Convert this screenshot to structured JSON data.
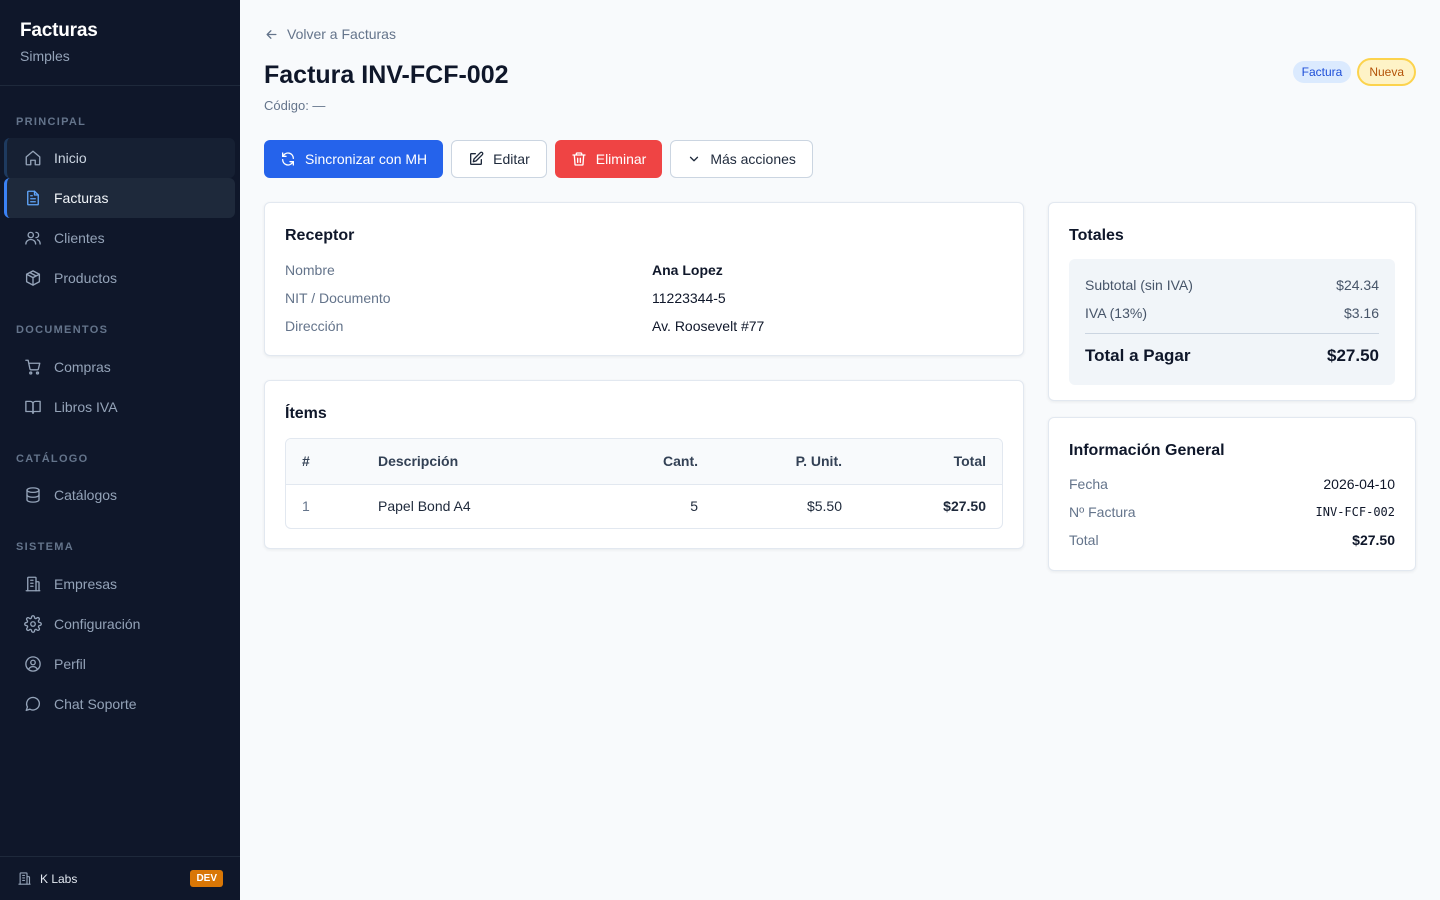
{
  "brand": {
    "title": "Facturas",
    "subtitle": "Simples"
  },
  "sidebar": {
    "sections": [
      {
        "label": "PRINCIPAL"
      },
      {
        "label": "DOCUMENTOS"
      },
      {
        "label": "CATÁLOGO"
      },
      {
        "label": "SISTEMA"
      }
    ],
    "items": [
      {
        "label": "Inicio",
        "icon": "home-icon"
      },
      {
        "label": "Facturas",
        "icon": "file-text-icon",
        "active": true
      },
      {
        "label": "Clientes",
        "icon": "users-icon"
      },
      {
        "label": "Productos",
        "icon": "package-icon"
      },
      {
        "label": "Compras",
        "icon": "cart-icon"
      },
      {
        "label": "Libros IVA",
        "icon": "book-icon"
      },
      {
        "label": "Catálogos",
        "icon": "database-icon"
      },
      {
        "label": "Empresas",
        "icon": "building-icon"
      },
      {
        "label": "Configuración",
        "icon": "gear-icon"
      },
      {
        "label": "Perfil",
        "icon": "user-circle-icon"
      },
      {
        "label": "Chat Soporte",
        "icon": "chat-icon"
      }
    ],
    "footer": {
      "org": "K Labs",
      "env_badge": "DEV"
    }
  },
  "header": {
    "back_link": "Volver a Facturas",
    "title": "Factura INV-FCF-002",
    "code": "Código: —",
    "badge_type": "Factura",
    "badge_status": "Nueva"
  },
  "actions": {
    "sync": "Sincronizar con MH",
    "edit": "Editar",
    "delete": "Eliminar",
    "more": "Más acciones"
  },
  "receptor": {
    "title": "Receptor",
    "fields": [
      {
        "label": "Nombre",
        "value": "Ana Lopez"
      },
      {
        "label": "NIT / Documento",
        "value": "11223344-5"
      },
      {
        "label": "Dirección",
        "value": "Av. Roosevelt #77"
      }
    ]
  },
  "items": {
    "title": "Ítems",
    "columns": [
      "#",
      "Descripción",
      "Cant.",
      "P. Unit.",
      "Total"
    ],
    "rows": [
      {
        "n": "1",
        "desc": "Papel Bond A4",
        "qty": "5",
        "unit": "$5.50",
        "total": "$27.50"
      }
    ]
  },
  "totals": {
    "title": "Totales",
    "subtotal_label": "Subtotal (sin IVA)",
    "subtotal_value": "$24.34",
    "iva_label": "IVA (13%)",
    "iva_value": "$3.16",
    "total_label": "Total a Pagar",
    "total_value": "$27.50"
  },
  "info": {
    "title": "Información General",
    "fecha_label": "Fecha",
    "fecha_value": "2026-04-10",
    "numero_label": "Nº Factura",
    "numero_value": "INV-FCF-002",
    "total_label": "Total",
    "total_value": "$27.50"
  },
  "colors": {
    "primary": "#2563eb",
    "danger": "#ef4444",
    "sidebar_bg": "#0f172a",
    "accent": "#3b82f6"
  }
}
